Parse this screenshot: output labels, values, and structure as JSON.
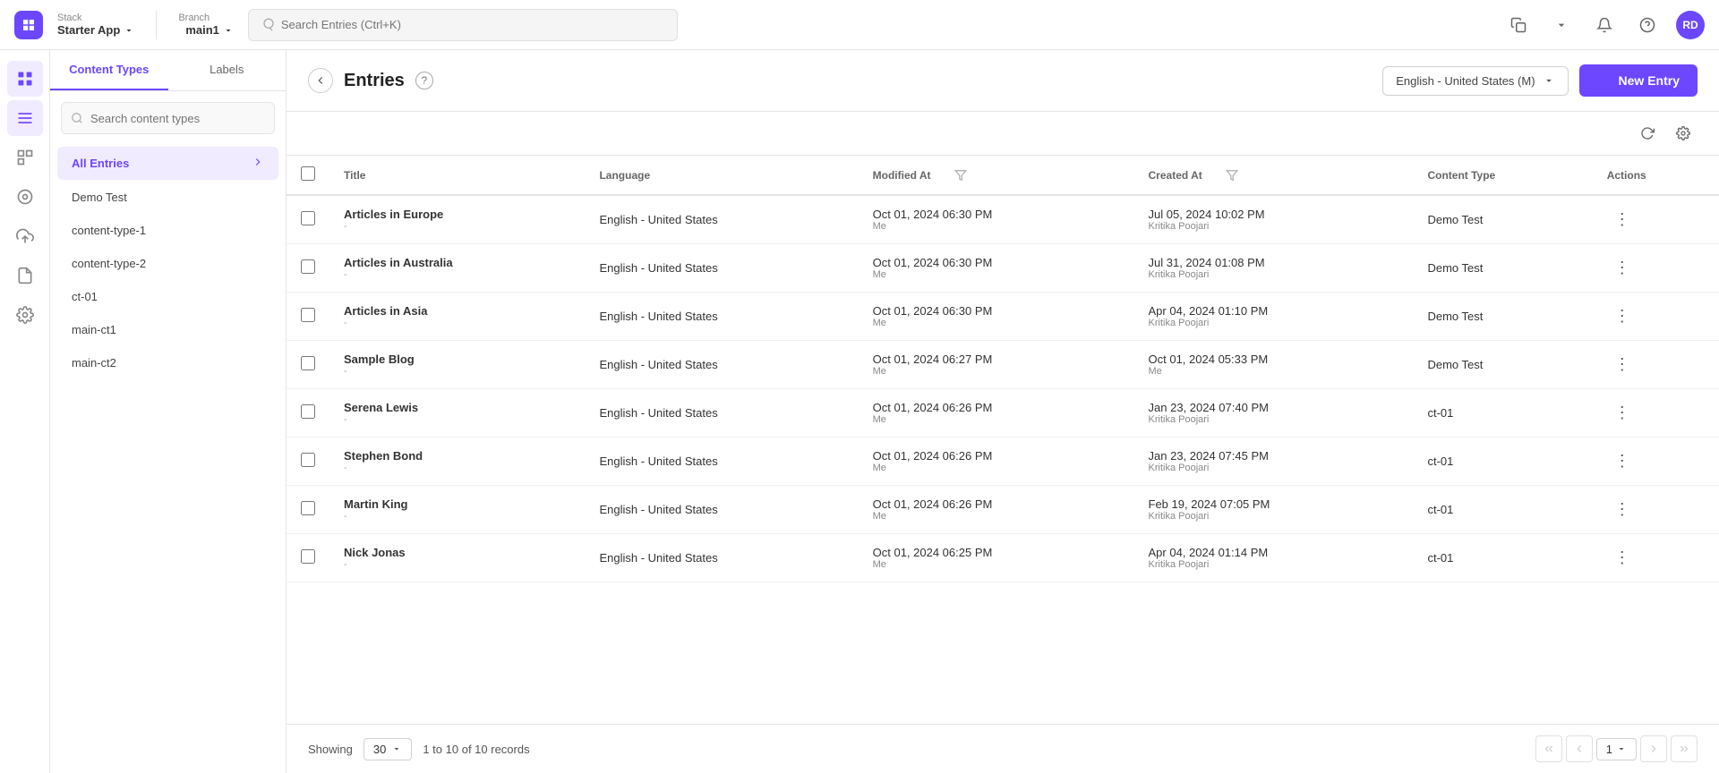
{
  "topnav": {
    "stack_label": "Stack",
    "app_name": "Starter App",
    "branch_label": "Branch",
    "branch_name": "main1",
    "search_placeholder": "Search Entries (Ctrl+K)",
    "avatar_initials": "RD"
  },
  "sidebar": {
    "icons": [
      {
        "name": "dashboard-icon",
        "symbol": "⊞",
        "active": false
      },
      {
        "name": "entries-icon",
        "symbol": "☰",
        "active": true
      },
      {
        "name": "analytics-icon",
        "symbol": "⊟",
        "active": false
      },
      {
        "name": "assets-icon",
        "symbol": "⬡",
        "active": false
      },
      {
        "name": "deploy-icon",
        "symbol": "↑",
        "active": false
      },
      {
        "name": "settings-icon",
        "symbol": "⊚",
        "active": false
      },
      {
        "name": "extensions-icon",
        "symbol": "⊛",
        "active": false
      }
    ]
  },
  "ct_sidebar": {
    "tabs": [
      {
        "label": "Content Types",
        "active": true
      },
      {
        "label": "Labels",
        "active": false
      }
    ],
    "search_placeholder": "Search content types",
    "items": [
      {
        "label": "All Entries",
        "active": true
      },
      {
        "label": "Demo Test",
        "active": false
      },
      {
        "label": "content-type-1",
        "active": false
      },
      {
        "label": "content-type-2",
        "active": false
      },
      {
        "label": "ct-01",
        "active": false
      },
      {
        "label": "main-ct1",
        "active": false
      },
      {
        "label": "main-ct2",
        "active": false
      }
    ]
  },
  "entries_header": {
    "title": "Entries",
    "language_label": "English - United States (M)",
    "new_entry_label": "New Entry"
  },
  "table": {
    "columns": [
      {
        "label": "Title",
        "sortable": true
      },
      {
        "label": "Language",
        "sortable": false
      },
      {
        "label": "Modified At",
        "sortable": true,
        "filterable": true
      },
      {
        "label": "Created At",
        "sortable": true,
        "filterable": true
      },
      {
        "label": "Content Type",
        "sortable": false
      },
      {
        "label": "Actions",
        "sortable": false
      }
    ],
    "rows": [
      {
        "title": "Articles in Europe",
        "title_sub": "-",
        "language": "English - United States",
        "modified_at": "Oct 01, 2024 06:30 PM",
        "modified_by": "Me",
        "created_at": "Jul 05, 2024 10:02 PM",
        "created_by": "Kritika Poojari",
        "content_type": "Demo Test"
      },
      {
        "title": "Articles in Australia",
        "title_sub": "-",
        "language": "English - United States",
        "modified_at": "Oct 01, 2024 06:30 PM",
        "modified_by": "Me",
        "created_at": "Jul 31, 2024 01:08 PM",
        "created_by": "Kritika Poojari",
        "content_type": "Demo Test"
      },
      {
        "title": "Articles in Asia",
        "title_sub": "-",
        "language": "English - United States",
        "modified_at": "Oct 01, 2024 06:30 PM",
        "modified_by": "Me",
        "created_at": "Apr 04, 2024 01:10 PM",
        "created_by": "Kritika Poojari",
        "content_type": "Demo Test"
      },
      {
        "title": "Sample Blog",
        "title_sub": "-",
        "language": "English - United States",
        "modified_at": "Oct 01, 2024 06:27 PM",
        "modified_by": "Me",
        "created_at": "Oct 01, 2024 05:33 PM",
        "created_by": "Me",
        "content_type": "Demo Test"
      },
      {
        "title": "Serena Lewis",
        "title_sub": "-",
        "language": "English - United States",
        "modified_at": "Oct 01, 2024 06:26 PM",
        "modified_by": "Me",
        "created_at": "Jan 23, 2024 07:40 PM",
        "created_by": "Kritika Poojari",
        "content_type": "ct-01"
      },
      {
        "title": "Stephen Bond",
        "title_sub": "-",
        "language": "English - United States",
        "modified_at": "Oct 01, 2024 06:26 PM",
        "modified_by": "Me",
        "created_at": "Jan 23, 2024 07:45 PM",
        "created_by": "Kritika Poojari",
        "content_type": "ct-01"
      },
      {
        "title": "Martin King",
        "title_sub": "-",
        "language": "English - United States",
        "modified_at": "Oct 01, 2024 06:26 PM",
        "modified_by": "Me",
        "created_at": "Feb 19, 2024 07:05 PM",
        "created_by": "Kritika Poojari",
        "content_type": "ct-01"
      },
      {
        "title": "Nick Jonas",
        "title_sub": "-",
        "language": "English - United States",
        "modified_at": "Oct 01, 2024 06:25 PM",
        "modified_by": "Me",
        "created_at": "Apr 04, 2024 01:14 PM",
        "created_by": "Kritika Poojari",
        "content_type": "ct-01"
      }
    ]
  },
  "pagination": {
    "showing_label": "Showing",
    "page_size": "30",
    "records_label": "1 to 10 of 10 records",
    "current_page": "1"
  }
}
